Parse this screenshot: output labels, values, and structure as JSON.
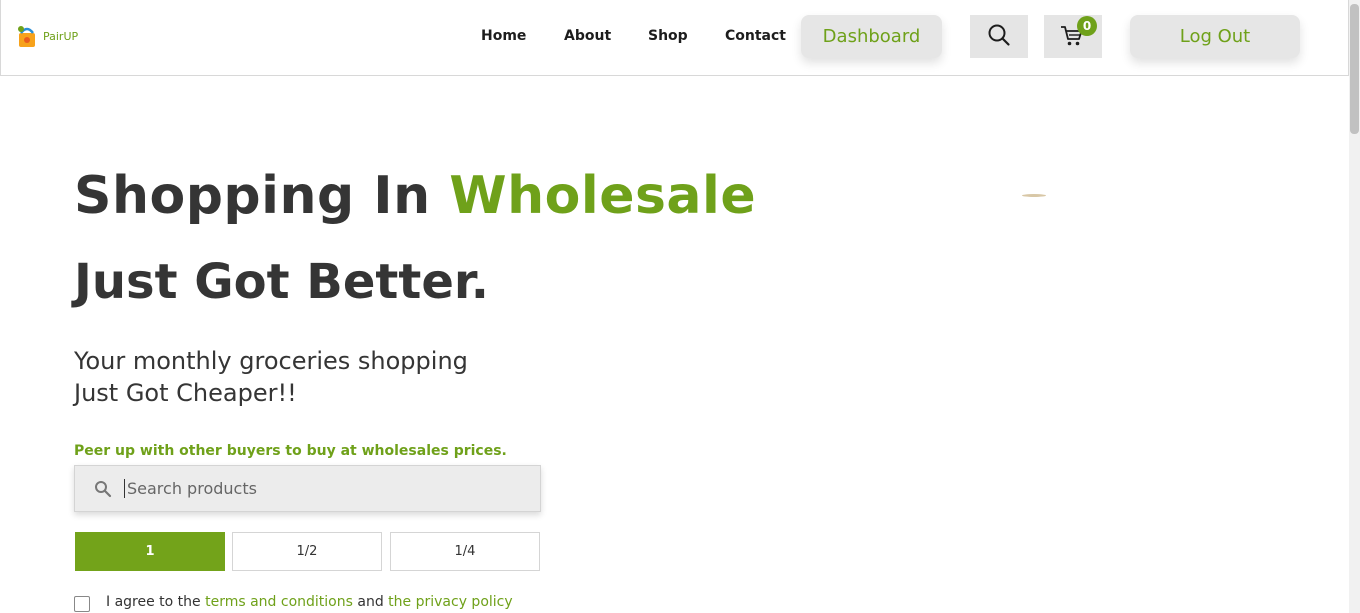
{
  "brand": {
    "name": "PairUP"
  },
  "nav": {
    "home": "Home",
    "about": "About",
    "shop": "Shop",
    "contact": "Contact",
    "dashboard": "Dashboard",
    "logout": "Log Out",
    "cart_count": "0"
  },
  "hero": {
    "line1_part1": "Shopping In ",
    "line1_highlight": "Wholesale",
    "line2": "Just Got Better.",
    "sub_line1": "Your monthly groceries shopping",
    "sub_line2": "Just Got Cheaper!!",
    "tagline": "Peer up with other buyers to buy at wholesales prices."
  },
  "search": {
    "placeholder": "Search products",
    "value": ""
  },
  "quantity_options": [
    "1",
    "1/2",
    "1/4"
  ],
  "selected_quantity": "1",
  "agreement": {
    "prefix": "I agree to the ",
    "terms": "terms and conditions",
    "middle": " and ",
    "privacy": "the privacy policy",
    "checked": false
  },
  "icons": [
    "logo-icon",
    "search-icon",
    "cart-icon",
    "magnifier-icon"
  ],
  "colors": {
    "accent": "#6fa11a",
    "text": "#353535",
    "button_bg": "#e6e6e6"
  }
}
